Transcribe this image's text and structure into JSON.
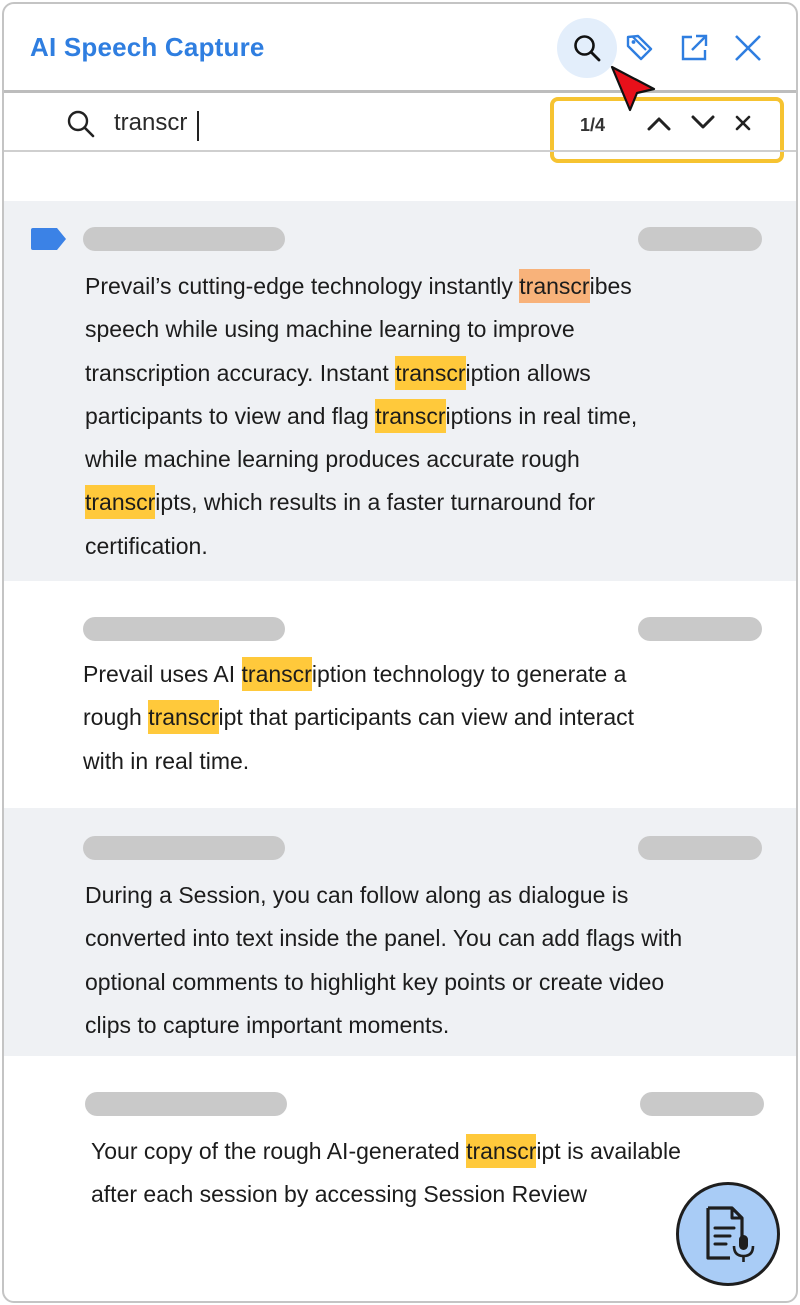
{
  "header": {
    "title": "AI Speech Capture",
    "icons": [
      "search-icon",
      "tag-icon",
      "external-link-icon",
      "close-icon"
    ]
  },
  "search": {
    "value": "transcr",
    "match_count": "1/4",
    "icons": [
      "search-icon",
      "chevron-up-icon",
      "chevron-down-icon",
      "close-icon"
    ]
  },
  "colors": {
    "accent": "#2f7ee0",
    "highlight": "#ffc93b",
    "current_highlight": "#f8b27a",
    "nav_border": "#f6c331",
    "flag": "#3b82e6",
    "fab": "#a9ccf6"
  },
  "entries": [
    {
      "flagged": true,
      "lines": [
        [
          {
            "t": "Prevail’s cutting-edge technology instantly "
          },
          {
            "t": "transcr",
            "h": "current"
          },
          {
            "t": "ibes"
          }
        ],
        [
          {
            "t": "speech while using machine learning to improve"
          }
        ],
        [
          {
            "t": "transcription accuracy. Instant "
          },
          {
            "t": "transcr",
            "h": "match"
          },
          {
            "t": "iption allows"
          }
        ],
        [
          {
            "t": "participants to view and flag "
          },
          {
            "t": "transcr",
            "h": "match"
          },
          {
            "t": "iptions in real time,"
          }
        ],
        [
          {
            "t": "while machine learning produces accurate rough"
          }
        ],
        [
          {
            "t": "transcr",
            "h": "match"
          },
          {
            "t": "ipts, which results in a faster turnaround for"
          }
        ],
        [
          {
            "t": "certification."
          }
        ]
      ]
    },
    {
      "flagged": false,
      "lines": [
        [
          {
            "t": "Prevail uses AI "
          },
          {
            "t": "transcr",
            "h": "match"
          },
          {
            "t": "iption technology to generate a"
          }
        ],
        [
          {
            "t": "rough "
          },
          {
            "t": "transcr",
            "h": "match"
          },
          {
            "t": "ipt that participants can view and interact"
          }
        ],
        [
          {
            "t": "with in real time."
          }
        ]
      ]
    },
    {
      "flagged": false,
      "lines": [
        [
          {
            "t": "During a Session, you can follow along as dialogue is"
          }
        ],
        [
          {
            "t": "converted into text inside the panel. You can add flags with"
          }
        ],
        [
          {
            "t": "optional comments to highlight key points or create video"
          }
        ],
        [
          {
            "t": "clips to capture important moments."
          }
        ]
      ]
    },
    {
      "flagged": false,
      "lines": [
        [
          {
            "t": "Your copy of the rough AI-generated "
          },
          {
            "t": "transcr",
            "h": "match"
          },
          {
            "t": "ipt is available"
          }
        ],
        [
          {
            "t": "after each session by accessing Session Review"
          }
        ]
      ]
    }
  ],
  "fab_icon": "transcript-mic-icon"
}
